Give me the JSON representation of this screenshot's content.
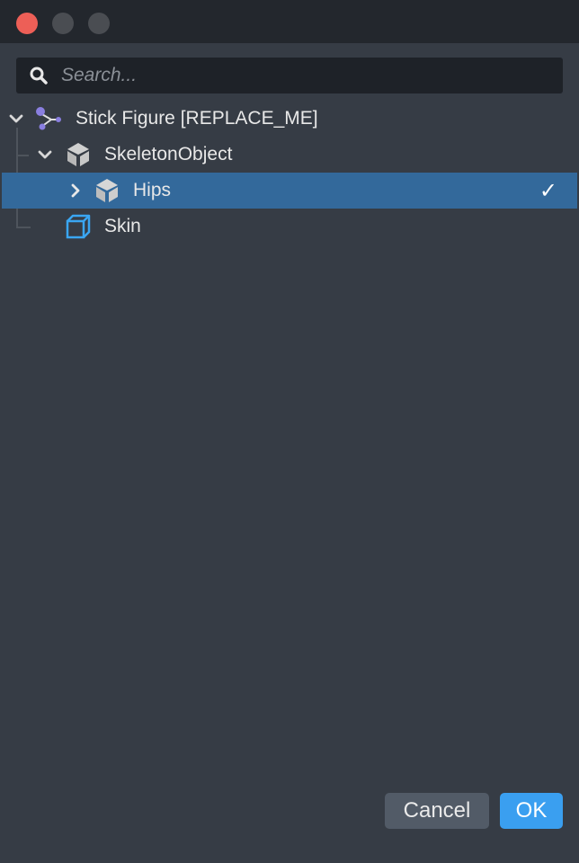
{
  "search": {
    "placeholder": "Search..."
  },
  "tree": {
    "root": {
      "label": "Stick Figure [REPLACE_ME]",
      "icon": "graph-nodes-icon",
      "expanded": true
    },
    "skeleton": {
      "label": "SkeletonObject",
      "icon": "skeleton-object-icon",
      "expanded": true
    },
    "hips": {
      "label": "Hips",
      "icon": "bone-icon",
      "expanded": false,
      "selected": true,
      "check": "✓"
    },
    "skin": {
      "label": "Skin",
      "icon": "cube-icon"
    }
  },
  "buttons": {
    "cancel": "Cancel",
    "ok": "OK"
  },
  "colors": {
    "window_bg": "#363c45",
    "selection": "#33699b",
    "accent": "#3a9ff0",
    "close": "#ed5f57",
    "node_purple": "#8a7fe0",
    "skin_blue": "#3aa6f2"
  }
}
